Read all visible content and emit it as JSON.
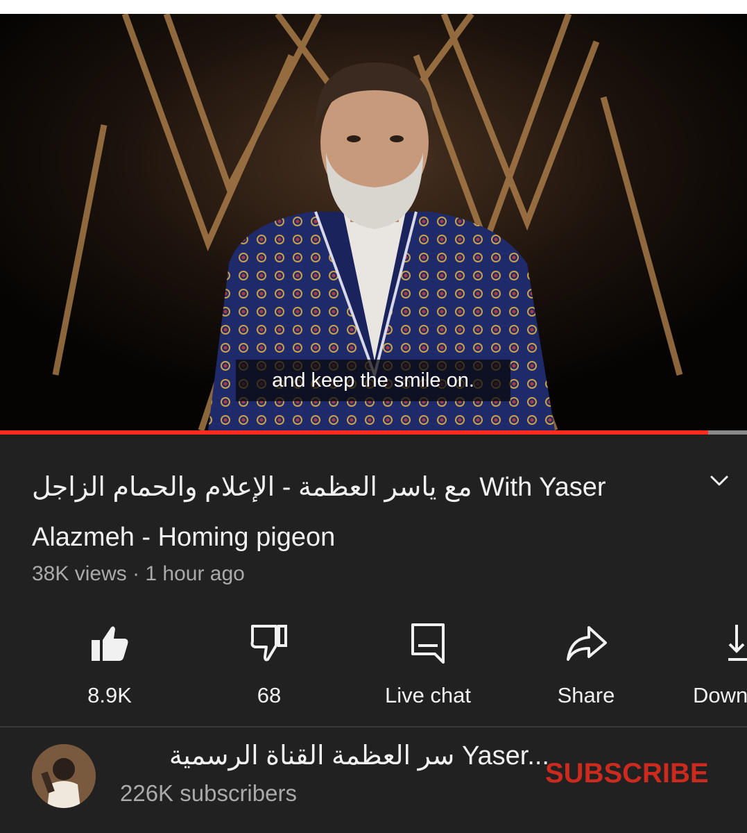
{
  "video": {
    "caption": "and keep the smile on.",
    "progress_fraction": 0.948
  },
  "details": {
    "title_line1": "مع ياسر العظمة - الإعلام والحمام الزاجل With Yaser",
    "title_line2": "Alazmeh - Homing pigeon",
    "meta": "38K views · 1 hour ago"
  },
  "actions": {
    "like_label": "8.9K",
    "dislike_label": "68",
    "livechat_label": "Live chat",
    "share_label": "Share",
    "download_label": "Down"
  },
  "channel": {
    "name": "سر العظمة القناة الرسمية Yaser...",
    "subscribers": "226K subscribers",
    "subscribe_label": "SUBSCRIBE"
  },
  "colors": {
    "background": "#212121",
    "progress": "#ff2b1e",
    "subscribe": "#cc2a1f"
  },
  "icons": [
    "like-icon",
    "dislike-icon",
    "live-chat-icon",
    "share-icon",
    "download-icon",
    "chevron-down-icon"
  ]
}
